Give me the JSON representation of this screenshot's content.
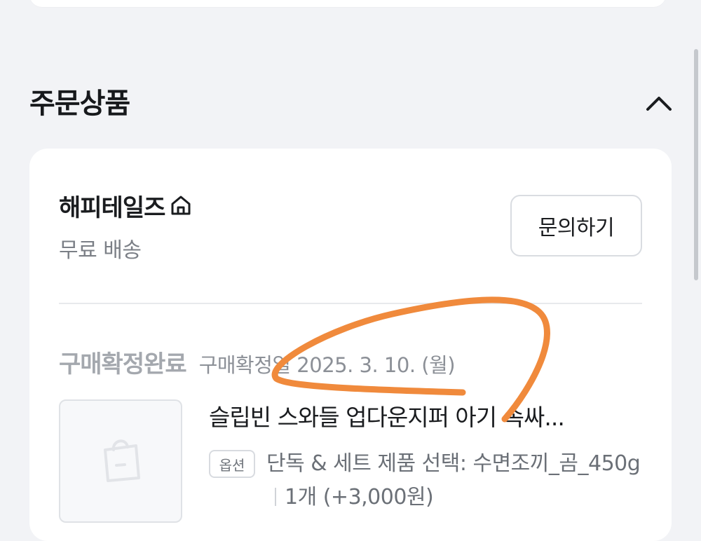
{
  "section": {
    "title": "주문상품"
  },
  "seller": {
    "name": "해피테일즈",
    "shipping": "무료 배송",
    "inquiry_label": "문의하기"
  },
  "order": {
    "status": "구매확정완료",
    "confirm_date_text": "구매확정일 2025. 3. 10. (월)"
  },
  "product": {
    "name": "슬립빈 스와들 업다운지퍼 아기 속싸...",
    "option_badge": "옵션",
    "option_text": "단독 & 세트 제품 선택: 수면조끼_곰_450g",
    "quantity": "1개 (+3,000원)"
  },
  "icons": {
    "collapse": "chevron-up-icon",
    "seller_home": "home-icon",
    "thumbnail": "shopping-bag-icon"
  },
  "colors": {
    "background": "#f2f3f6",
    "card": "#ffffff",
    "annotation_stroke": "#f08a3c"
  }
}
